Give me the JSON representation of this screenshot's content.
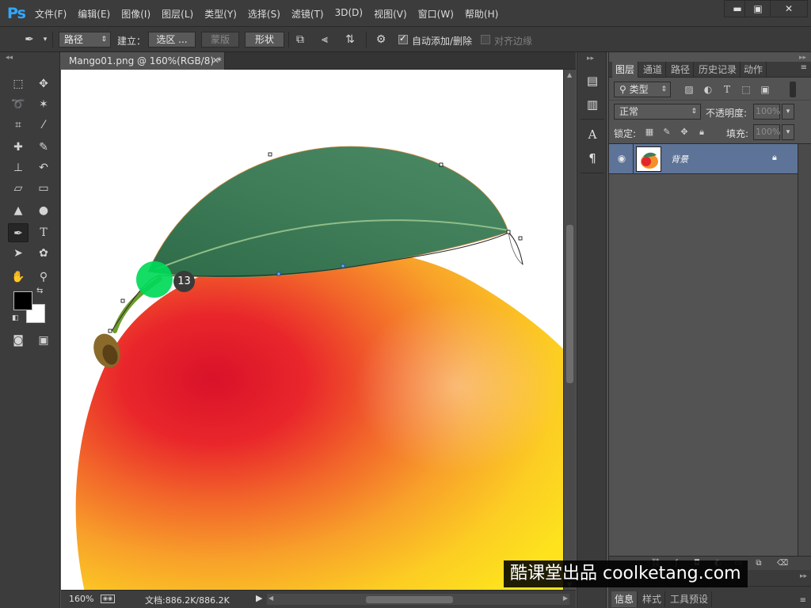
{
  "app": {
    "logo": "Ps",
    "menu": [
      "文件(F)",
      "编辑(E)",
      "图像(I)",
      "图层(L)",
      "类型(Y)",
      "选择(S)",
      "滤镜(T)",
      "3D(D)",
      "视图(V)",
      "窗口(W)",
      "帮助(H)"
    ],
    "window_controls": {
      "minimize": "▬",
      "maximize": "▣",
      "close": "✕"
    }
  },
  "options": {
    "tool_mode": "路径",
    "make_label": "建立：",
    "selection_button": "选区 ...",
    "mask_button": "蒙版",
    "shape_button": "形状",
    "auto_add_delete": "自动添加/删除",
    "auto_add_delete_checked": true,
    "align_edges": "对齐边缘",
    "align_edges_enabled": false
  },
  "document": {
    "tab_title": "Mango01.png @ 160%(RGB/8) *",
    "close_glyph": "✕"
  },
  "cursor": {
    "step_number": "13",
    "highlight_color": "#00d957"
  },
  "status": {
    "zoom": "160%",
    "doc_info": "文档:886.2K/886.2K"
  },
  "layers_panel": {
    "tabs": [
      "图层",
      "通道",
      "路径",
      "历史记录",
      "动作"
    ],
    "active_tab": "图层",
    "filter_kind": "类型",
    "blend_mode": "正常",
    "opacity_label": "不透明度:",
    "opacity_value": "100%",
    "lock_label": "锁定:",
    "fill_label": "填充:",
    "fill_value": "100%",
    "layers": [
      {
        "name": "背景",
        "visible": true,
        "locked": true,
        "selected": true
      }
    ]
  },
  "bottom_panel": {
    "tabs": [
      "信息",
      "样式",
      "工具预设"
    ],
    "active_tab": "信息"
  },
  "watermark": "酷课堂出品 coolketang.com",
  "colors": {
    "app_bg": "#535353",
    "menubar": "#3c3c3c",
    "ps_blue": "#31a8ff",
    "selected_layer": "#5d7398",
    "leaf_green": "#3f7d59",
    "mango_red": "#e9262b",
    "mango_yellow": "#fcd41a"
  }
}
